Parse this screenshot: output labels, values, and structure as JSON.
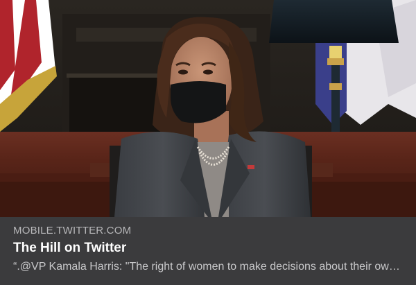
{
  "link_card": {
    "domain": "MOBILE.TWITTER.COM",
    "title": "The Hill on Twitter",
    "description": "“.@VP Kamala Harris: \"The right of women to make decisions about their own bodies…\""
  },
  "colors": {
    "card_background": "#3b3b3d",
    "domain_text": "#b8b8ba",
    "title_text": "#ffffff",
    "description_text": "#c9c9cb"
  }
}
